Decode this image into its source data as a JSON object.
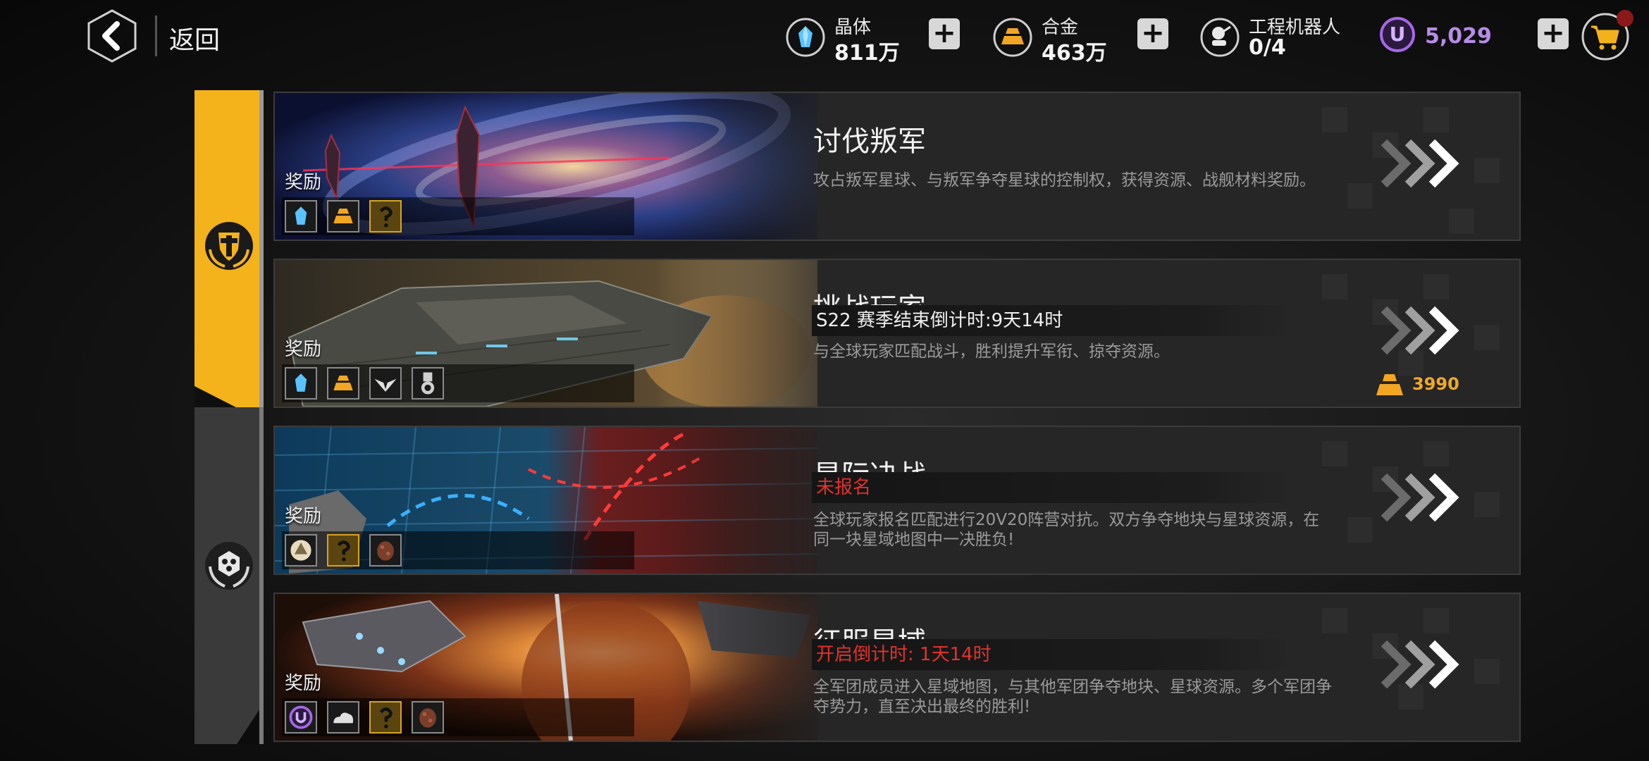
{
  "header": {
    "back_label": "返回",
    "resources": [
      {
        "name": "晶体",
        "value": "811万",
        "icon": "crystal-icon"
      },
      {
        "name": "合金",
        "value": "463万",
        "icon": "alloy-icon"
      },
      {
        "name": "工程机器人",
        "value": "0/4",
        "icon": "robot-icon"
      }
    ],
    "credits": {
      "icon_letter": "U",
      "value": "5,029"
    },
    "plus_label": "+"
  },
  "sidebar": {
    "tabs": [
      {
        "name": "pve-tab",
        "icon": "shield-laurel-icon",
        "active": true
      },
      {
        "name": "alliance-tab",
        "icon": "hexagon-laurel-icon",
        "active": false
      }
    ]
  },
  "cards": [
    {
      "title": "讨伐叛军",
      "reward_label": "奖励",
      "status": "",
      "description": "攻占叛军星球、与叛军争夺星球的控制权，获得资源、战舰材料奖励。",
      "rewards": [
        "crystal-icon",
        "alloy-icon",
        "blueprint-icon"
      ],
      "badge_value": ""
    },
    {
      "title": "挑战玩家",
      "reward_label": "奖励",
      "status": "S22 赛季结束倒计时:9天14时",
      "description": "与全球玩家匹配战斗，胜利提升军衔、掠夺资源。",
      "rewards": [
        "crystal-icon",
        "alloy-icon",
        "wings-icon",
        "medal-icon"
      ],
      "badge_value": "3990"
    },
    {
      "title": "星际决战",
      "reward_label": "奖励",
      "status": "未报名",
      "description": "全球玩家报名匹配进行20V20阵营对抗。双方争夺地块与星球资源，在同一块星域地图中一决胜负!",
      "rewards": [
        "emblem-icon",
        "blueprint-icon",
        "ore-icon"
      ],
      "badge_value": ""
    },
    {
      "title": "征服星域",
      "reward_label": "奖励",
      "status": "开启倒计时: 1天14时",
      "description": "全军团成员进入星域地图，与其他军团争夺地块、星球资源。多个军团争夺势力，直至决出最终的胜利!",
      "rewards": [
        "credit-icon",
        "cloud-icon",
        "blueprint-icon",
        "ore-icon"
      ],
      "badge_value": ""
    }
  ],
  "colors": {
    "gold_tab": "#f4b21b",
    "status_white": "#f0f0f0",
    "status_red": "#e0332e",
    "badge_orange": "#f0a92a",
    "credit_purple": "#b68ce8"
  }
}
